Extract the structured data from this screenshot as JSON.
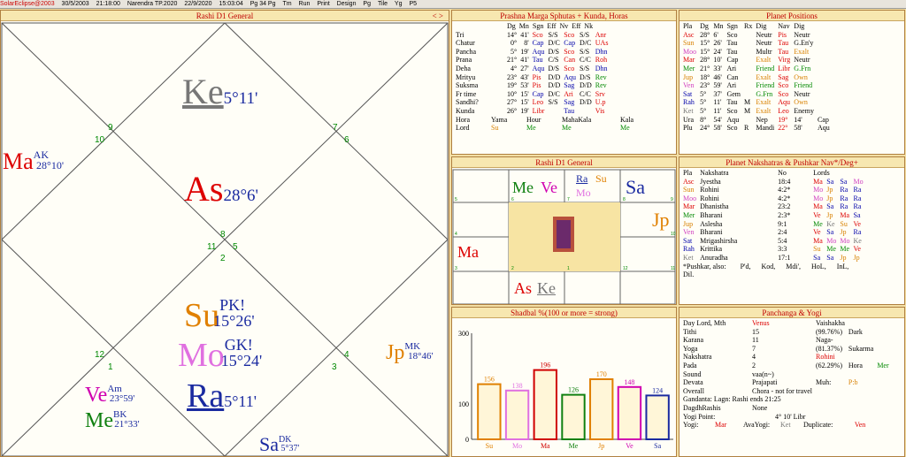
{
  "toolbar": {
    "items": [
      "SolarEclipse@2003",
      "30/5/2003",
      "21:18:00",
      "Narendra TP.2020",
      "22/9/2020",
      "15:03:04",
      "Pg 34 Pg",
      "Tm",
      "Run",
      "Print",
      "Design",
      "Pg",
      "Tile",
      "Yg",
      "P5"
    ]
  },
  "rashi_main": {
    "title": "Rashi D1 General",
    "nav": "< >",
    "planets": [
      {
        "abbr": "Ke",
        "sup": "",
        "deg": "5°11'",
        "color": "#777777"
      },
      {
        "abbr": "As",
        "sup": "",
        "deg": "28°6'",
        "color": "#d00000"
      },
      {
        "abbr": "Ma",
        "sup": "AK",
        "deg": "28°10'",
        "color": "#d00000"
      },
      {
        "abbr": "Su",
        "sup": "PK!",
        "deg": "15°26'",
        "color": "#e08000"
      },
      {
        "abbr": "Mo",
        "sup": "GK!",
        "deg": "15°24'",
        "color": "#e070e0"
      },
      {
        "abbr": "Ra",
        "sup": "",
        "deg": "5°11'",
        "color": "#1a2aa0"
      },
      {
        "abbr": "Ve",
        "sup": "Am",
        "deg": "23°59'",
        "color": "#d000b0"
      },
      {
        "abbr": "Me",
        "sup": "BK",
        "deg": "21°33'",
        "color": "#108010"
      },
      {
        "abbr": "Jp",
        "sup": "MK",
        "deg": "18°46'",
        "color": "#e08000"
      },
      {
        "abbr": "Sa",
        "sup": "DK",
        "deg": "5°37'",
        "color": "#1a2aa0"
      }
    ],
    "house_numbers": [
      "9",
      "10",
      "7",
      "6",
      "8",
      "11",
      "5",
      "2",
      "12",
      "1",
      "4",
      "3"
    ]
  },
  "prashna": {
    "title": "Prashna Marga Sphutas + Kunda, Horas",
    "headers": [
      "",
      "Dg",
      "Mn",
      "Sgn",
      "Eff",
      "Nv",
      "Eff",
      "Nk"
    ],
    "rows": [
      [
        "Tri",
        "14°",
        "41'",
        "Sco",
        "S/S",
        "Sco",
        "S/S",
        "Anr"
      ],
      [
        "Chatur",
        "0°",
        "8'",
        "Cap",
        "D/C",
        "Cap",
        "D/C",
        "UAs"
      ],
      [
        "Pancha",
        "5°",
        "19'",
        "Aqu",
        "D/S",
        "Sco",
        "S/S",
        "Dhn"
      ],
      [
        "Prana",
        "21°",
        "41'",
        "Tau",
        "C/S",
        "Can",
        "C/C",
        "Roh"
      ],
      [
        "Deha",
        "4°",
        "27'",
        "Aqu",
        "D/S",
        "Sco",
        "S/S",
        "Dhn"
      ],
      [
        "Mrityu",
        "23°",
        "43'",
        "Pis",
        "D/D",
        "Aqu",
        "D/S",
        "Rev"
      ],
      [
        "Suksma",
        "19°",
        "53'",
        "Pis",
        "D/D",
        "Sag",
        "D/D",
        "Rev"
      ],
      [
        "Fr time",
        "10°",
        "15'",
        "Cap",
        "D/C",
        "Ari",
        "C/C",
        "Srv"
      ],
      [
        "Sandhi?",
        "27°",
        "15'",
        "Leo",
        "S/S",
        "Sag",
        "D/D",
        "U.p"
      ],
      [
        "Kunda",
        "26°",
        "19'",
        "Libr",
        "",
        "Tau",
        "",
        "Vis"
      ]
    ],
    "hora_row": [
      "Hora",
      "Yama",
      "Hour",
      "MahaKala",
      "Kala"
    ],
    "lord_row": [
      "Lord",
      "Su",
      "Me",
      "Me",
      "Me"
    ]
  },
  "positions": {
    "title": "Planet Positions",
    "headers": [
      "Pla",
      "Dg",
      "Mn",
      "Sgn",
      "Rx",
      "Dig",
      "Nav",
      "Dig"
    ],
    "rows": [
      [
        "Asc",
        "28°",
        "6'",
        "Sco",
        "",
        "Neutr",
        "Pis",
        "Neutr"
      ],
      [
        "Sun",
        "15°",
        "26'",
        "Tau",
        "",
        "Neutr",
        "Tau",
        "G.En'y"
      ],
      [
        "Moo",
        "15°",
        "24'",
        "Tau",
        "",
        "Multr",
        "Tau",
        "Exalt"
      ],
      [
        "Mar",
        "28°",
        "10'",
        "Cap",
        "",
        "Exalt",
        "Virg",
        "Neutr"
      ],
      [
        "Mer",
        "21°",
        "33'",
        "Ari",
        "",
        "Friend",
        "Libr",
        "G.Frn"
      ],
      [
        "Jup",
        "18°",
        "46'",
        "Can",
        "",
        "Exalt",
        "Sag",
        "Own"
      ],
      [
        "Ven",
        "23°",
        "59'",
        "Ari",
        "",
        "Friend",
        "Sco",
        "Friend"
      ],
      [
        "Sat",
        "5°",
        "37'",
        "Gem",
        "",
        "G.Frn",
        "Sco",
        "Neutr"
      ],
      [
        "Rah",
        "5°",
        "11'",
        "Tau",
        "M",
        "Exalt",
        "Aqu",
        "Own"
      ],
      [
        "Ket",
        "5°",
        "11'",
        "Sco",
        "M",
        "Exalt",
        "Leo",
        "Enemy"
      ],
      [
        "Ura",
        "8°",
        "54'",
        "Aqu",
        "",
        "Nep",
        "19°",
        "14'",
        "Cap"
      ],
      [
        "Plu",
        "24°",
        "58'",
        "Sco",
        "R",
        "Mandi",
        "22°",
        "58'",
        "Aqu"
      ]
    ]
  },
  "rashi_small": {
    "title": "Rashi D1 General",
    "cells": [
      "Me",
      "Ve",
      "Ra",
      "Su",
      "Mo",
      "Sa",
      "Jp",
      "Ma",
      "As",
      "Ke"
    ],
    "numbers": [
      "5",
      "6",
      "7",
      "8",
      "9",
      "4",
      "10",
      "3",
      "2",
      "1",
      "12",
      "11"
    ]
  },
  "nakshatras": {
    "title": "Planet Nakshatras & Pushkar Nav*/Deg+",
    "headers": [
      "Pla",
      "Nakshatra",
      "No",
      "Lords"
    ],
    "rows": [
      [
        "Asc",
        "Jyestha",
        "18:4",
        "Ma",
        "Sa",
        "Sa",
        "Mo"
      ],
      [
        "Sun",
        "Rohini",
        "4:2*",
        "Mo",
        "Jp",
        "Ra",
        "Ra"
      ],
      [
        "Moo",
        "Rohini",
        "4:2*",
        "Mo",
        "Jp",
        "Ra",
        "Ra"
      ],
      [
        "Mar",
        "Dhanistha",
        "23:2",
        "Ma",
        "Sa",
        "Ra",
        "Ra"
      ],
      [
        "Mer",
        "Bharani",
        "2:3*",
        "Ve",
        "Jp",
        "Ma",
        "Sa"
      ],
      [
        "Jup",
        "Aslesha",
        "9:1",
        "Me",
        "Ke",
        "Su",
        "Ve"
      ],
      [
        "Ven",
        "Bharani",
        "2:4",
        "Ve",
        "Sa",
        "Jp",
        "Ra"
      ],
      [
        "Sat",
        "Mrigashirsha",
        "5:4",
        "Ma",
        "Mo",
        "Mo",
        "Ke"
      ],
      [
        "Rah",
        "Krittika",
        "3:3",
        "Su",
        "Me",
        "Me",
        "Ve"
      ],
      [
        "Ket",
        "Anuradha",
        "17:1",
        "Sa",
        "Sa",
        "Jp",
        "Jp"
      ]
    ],
    "pushkar": [
      "*Pushkar, also:",
      "P'd,",
      "Kod,",
      "Mdi',",
      "HoL,",
      "InL,",
      "Dil."
    ]
  },
  "shadbal": {
    "title": "Shadbal %(100 or more = strong)",
    "chart_data": {
      "type": "bar",
      "categories": [
        "Su",
        "Mo",
        "Ma",
        "Me",
        "Jp",
        "Ve",
        "Sa"
      ],
      "values": [
        156,
        138,
        196,
        126,
        170,
        148,
        124
      ],
      "colors": [
        "#e08000",
        "#e070e0",
        "#d00000",
        "#108010",
        "#e08000",
        "#d000b0",
        "#1a2aa0"
      ],
      "ylim": [
        0,
        300
      ],
      "yticks": [
        "300",
        "100",
        "0"
      ],
      "title": "Shadbal %(100 or more = strong)"
    }
  },
  "panchanga": {
    "title": "Panchanga & Yogi",
    "rows": [
      [
        "Day Lord, Mth",
        "Venus",
        "Vaishakha",
        ""
      ],
      [
        "Tithi",
        "15",
        "(99.76%)",
        "Dark"
      ],
      [
        "Karana",
        "11",
        "Naga-",
        ""
      ],
      [
        "Yoga",
        "7",
        "(81.37%)",
        "Sukarma"
      ],
      [
        "Nakshatra",
        "4",
        "Rohini",
        ""
      ],
      [
        "Pada",
        "2",
        "(62.29%)",
        "Hora",
        "Mer"
      ],
      [
        "Sound",
        "vaa(n~)",
        "",
        ""
      ],
      [
        "Devata",
        "Prajapati",
        "Muh:",
        "P:b"
      ],
      [
        "Overall",
        "Chora - not for travel",
        "",
        ""
      ]
    ],
    "gandanta": "Gandanta: Lagn: Rashi ends 21:25",
    "dagdha": [
      "DagdhRashis",
      "None"
    ],
    "yogi_point": [
      "Yogi Point:",
      "4° 10' Libr"
    ],
    "yogi": [
      "Yogi:",
      "Mar",
      "AvaYogi:",
      "Ket",
      "Duplicate:",
      "Ven"
    ]
  }
}
